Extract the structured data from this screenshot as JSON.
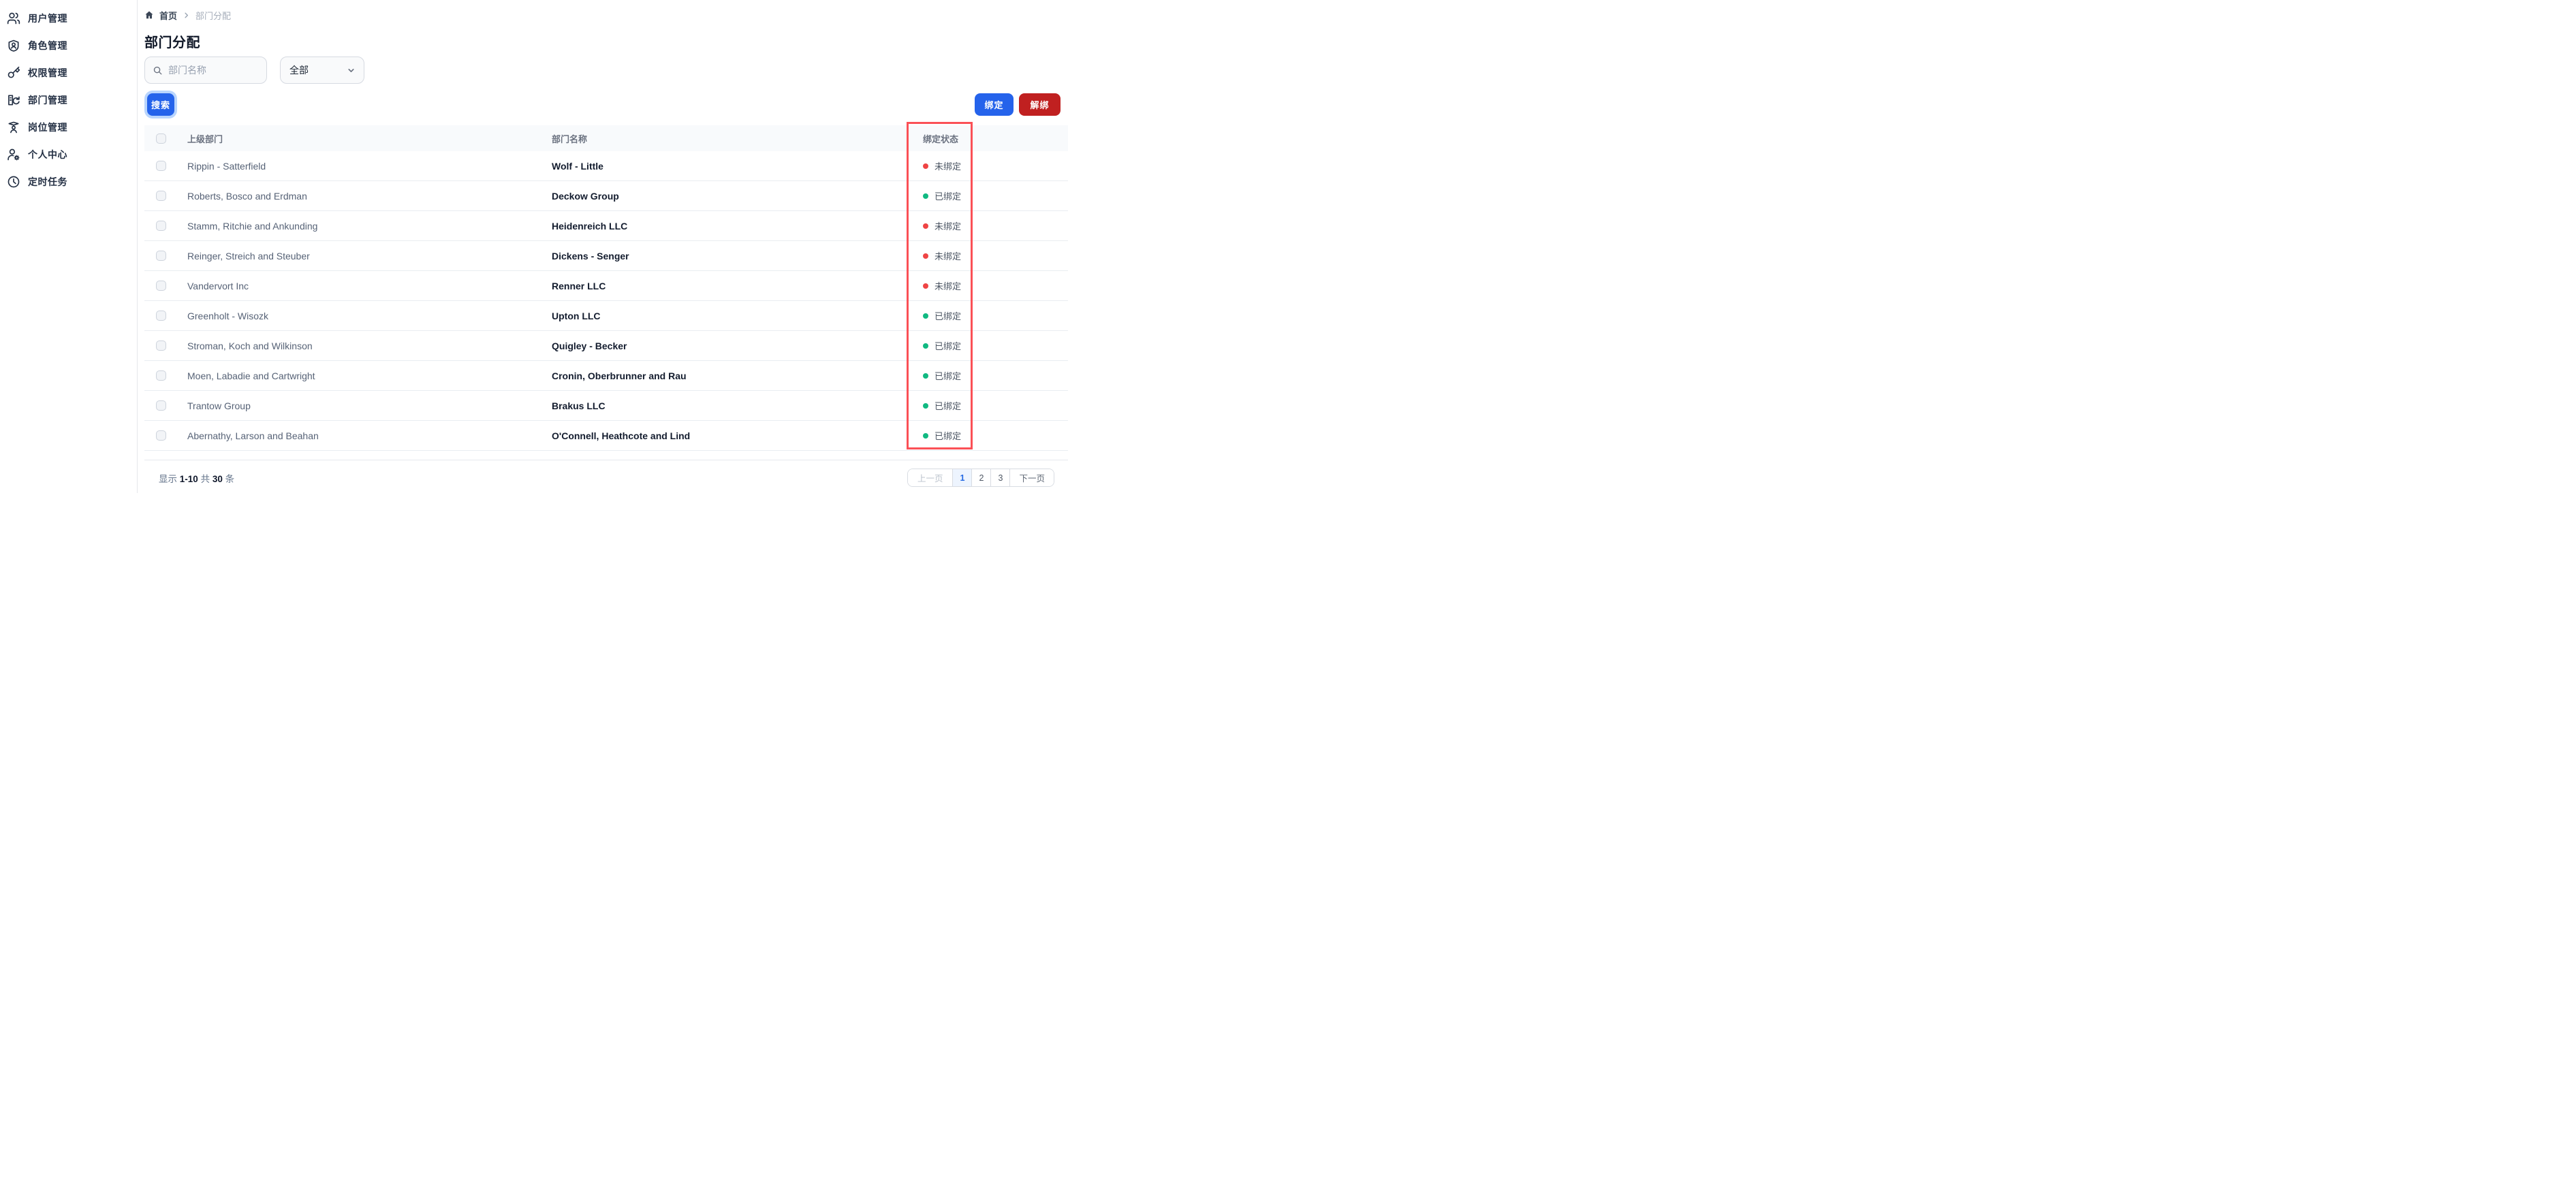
{
  "sidebar": {
    "items": [
      {
        "label": "用户管理",
        "icon": "users-icon"
      },
      {
        "label": "角色管理",
        "icon": "shield-user-icon"
      },
      {
        "label": "权限管理",
        "icon": "key-icon"
      },
      {
        "label": "部门管理",
        "icon": "department-icon"
      },
      {
        "label": "岗位管理",
        "icon": "position-icon"
      },
      {
        "label": "个人中心",
        "icon": "user-gear-icon"
      },
      {
        "label": "定时任务",
        "icon": "clock-icon"
      }
    ]
  },
  "breadcrumb": {
    "home": "首页",
    "current": "部门分配"
  },
  "page": {
    "title": "部门分配"
  },
  "filters": {
    "search_placeholder": "部门名称",
    "select_value": "全部",
    "search_button": "搜索"
  },
  "actions": {
    "bind": "绑定",
    "unbind": "解绑"
  },
  "table": {
    "headers": {
      "parent": "上级部门",
      "name": "部门名称",
      "status": "绑定状态"
    },
    "rows": [
      {
        "parent": "Rippin - Satterfield",
        "name": "Wolf - Little",
        "bound": false,
        "status": "未绑定"
      },
      {
        "parent": "Roberts, Bosco and Erdman",
        "name": "Deckow Group",
        "bound": true,
        "status": "已绑定"
      },
      {
        "parent": "Stamm, Ritchie and Ankunding",
        "name": "Heidenreich LLC",
        "bound": false,
        "status": "未绑定"
      },
      {
        "parent": "Reinger, Streich and Steuber",
        "name": "Dickens - Senger",
        "bound": false,
        "status": "未绑定"
      },
      {
        "parent": "Vandervort Inc",
        "name": "Renner LLC",
        "bound": false,
        "status": "未绑定"
      },
      {
        "parent": "Greenholt - Wisozk",
        "name": "Upton LLC",
        "bound": true,
        "status": "已绑定"
      },
      {
        "parent": "Stroman, Koch and Wilkinson",
        "name": "Quigley - Becker",
        "bound": true,
        "status": "已绑定"
      },
      {
        "parent": "Moen, Labadie and Cartwright",
        "name": "Cronin, Oberbrunner and Rau",
        "bound": true,
        "status": "已绑定"
      },
      {
        "parent": "Trantow Group",
        "name": "Brakus LLC",
        "bound": true,
        "status": "已绑定"
      },
      {
        "parent": "Abernathy, Larson and Beahan",
        "name": "O'Connell, Heathcote and Lind",
        "bound": true,
        "status": "已绑定"
      }
    ]
  },
  "pagination": {
    "summary_prefix": "显示",
    "range": "1-10",
    "of_label": "共",
    "total": "30",
    "unit": "条",
    "prev": "上一页",
    "pages": [
      "1",
      "2",
      "3"
    ],
    "active_page": "1",
    "next": "下一页"
  },
  "colors": {
    "accent_blue": "#2563eb",
    "danger_red": "#c02020",
    "status_bound_green": "#10b981",
    "status_unbound_red": "#ef4444",
    "annotation_red": "#fb5056",
    "header_bg": "#f8fafc"
  }
}
